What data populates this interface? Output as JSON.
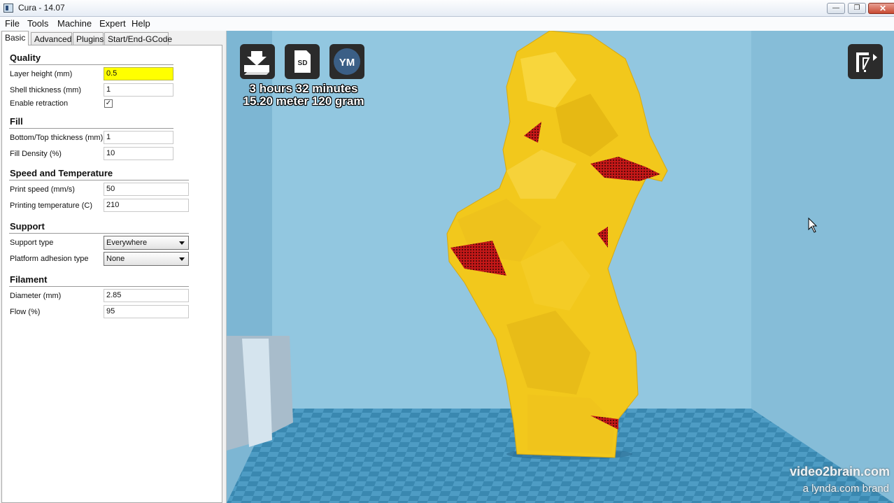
{
  "window": {
    "title": "Cura - 14.07",
    "minimize": "—",
    "maximize": "❐",
    "close": "✕"
  },
  "menu": [
    "File",
    "Tools",
    "Machine",
    "Expert",
    "Help"
  ],
  "tabs": [
    "Basic",
    "Advanced",
    "Plugins",
    "Start/End-GCode"
  ],
  "active_tab": "Basic",
  "sections": {
    "quality": {
      "title": "Quality",
      "layer_height": {
        "label": "Layer height (mm)",
        "value": "0.5"
      },
      "shell_thickness": {
        "label": "Shell thickness (mm)",
        "value": "1"
      },
      "enable_retraction": {
        "label": "Enable retraction",
        "checked": "✓"
      }
    },
    "fill": {
      "title": "Fill",
      "bottom_top_thickness": {
        "label": "Bottom/Top thickness (mm)",
        "value": "1"
      },
      "fill_density": {
        "label": "Fill Density (%)",
        "value": "10"
      }
    },
    "speed": {
      "title": "Speed and Temperature",
      "print_speed": {
        "label": "Print speed (mm/s)",
        "value": "50"
      },
      "printing_temperature": {
        "label": "Printing temperature (C)",
        "value": "210"
      }
    },
    "support": {
      "title": "Support",
      "support_type": {
        "label": "Support type",
        "value": "Everywhere"
      },
      "platform_adhesion": {
        "label": "Platform adhesion type",
        "value": "None"
      }
    },
    "filament": {
      "title": "Filament",
      "diameter": {
        "label": "Diameter (mm)",
        "value": "2.85"
      },
      "flow": {
        "label": "Flow (%)",
        "value": "95"
      }
    }
  },
  "viewport": {
    "buttons": {
      "sd": "SD",
      "ym": "YM"
    },
    "print_time": "3 hours 32 minutes",
    "material": "15.20 meter 120 gram",
    "colors": {
      "model": "#f2c81c",
      "overhang": "#cc1a1a",
      "background": "#8fc3dc",
      "bed": "#3f8cb4"
    }
  },
  "watermark": {
    "line1": "video2brain.com",
    "line2": "a lynda.com brand"
  }
}
